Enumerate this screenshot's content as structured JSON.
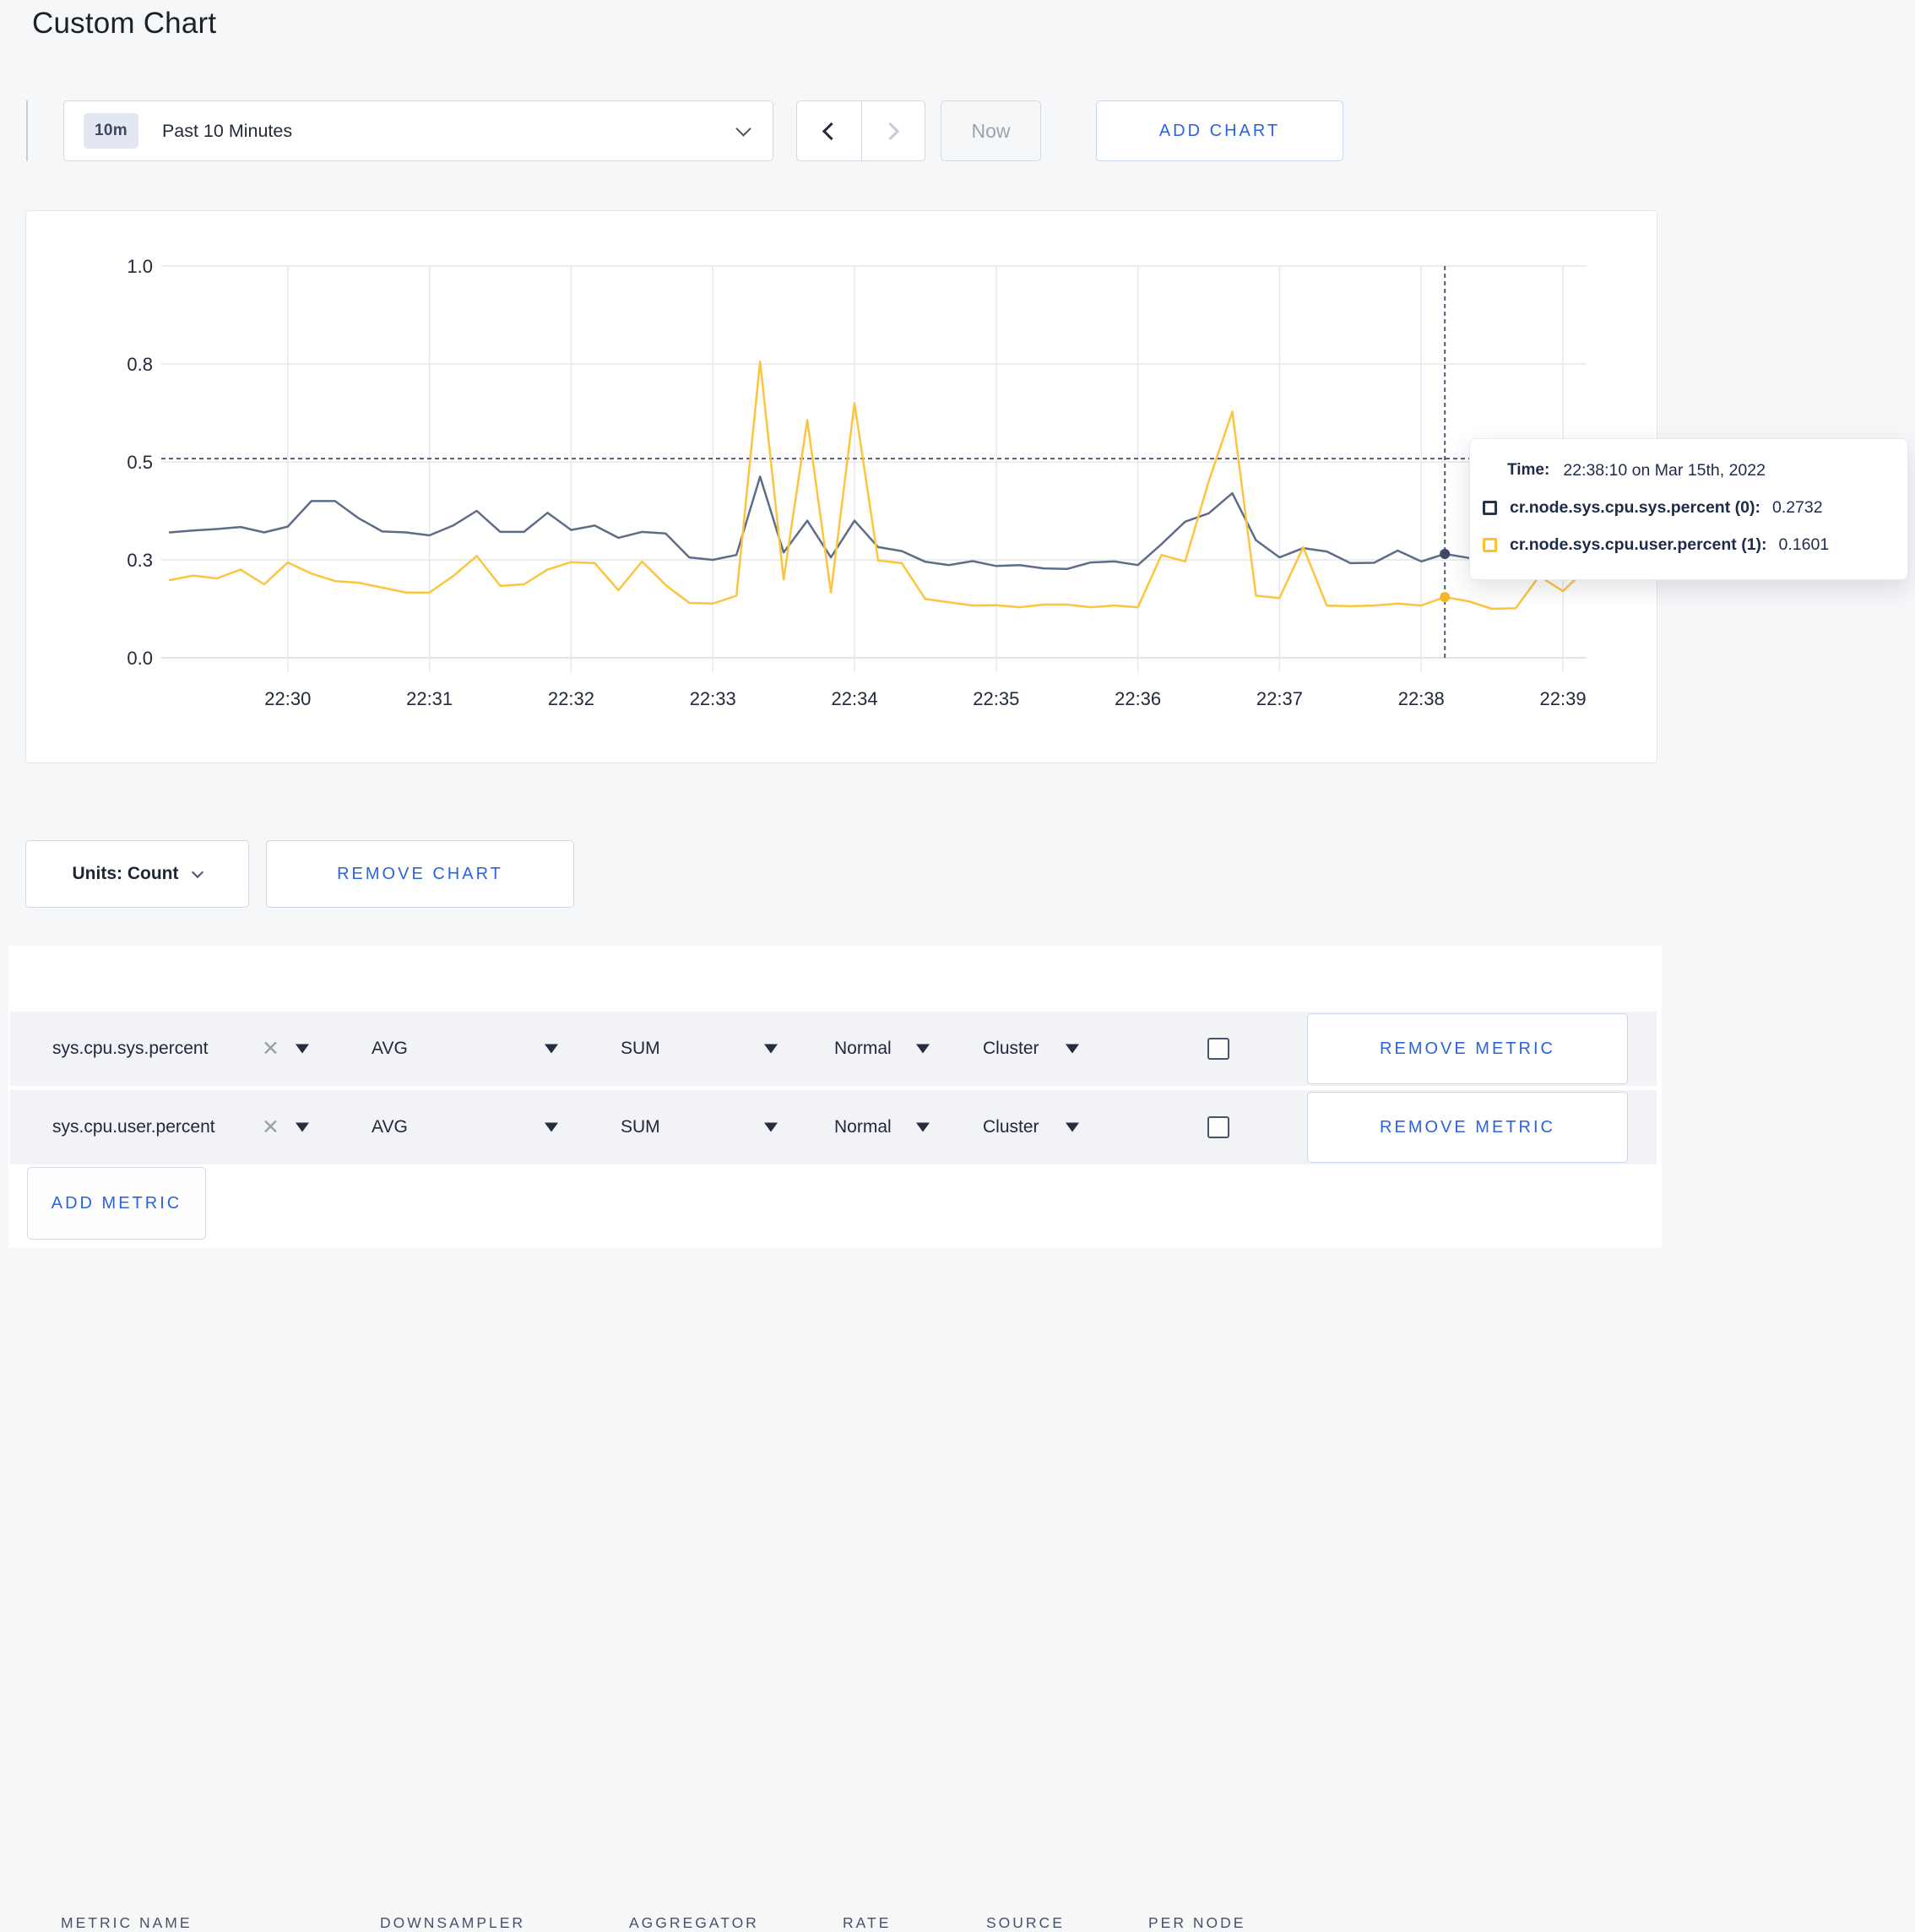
{
  "page": {
    "title": "Custom Chart"
  },
  "toolbar": {
    "time_badge": "10m",
    "time_label": "Past 10 Minutes",
    "time_dropdown_icon": "chevron-down-icon",
    "prev_icon": "chevron-left-icon",
    "next_icon": "chevron-right-icon",
    "now_label": "Now",
    "add_chart_label": "ADD CHART"
  },
  "chart_data": {
    "type": "line",
    "title": "",
    "xlabel": "",
    "ylabel": "",
    "x_tick_labels": [
      "22:30",
      "22:31",
      "22:32",
      "22:33",
      "22:34",
      "22:35",
      "22:36",
      "22:37",
      "22:38",
      "22:39"
    ],
    "y_tick_labels": [
      "0.0",
      "0.3",
      "0.5",
      "0.8",
      "1.0"
    ],
    "y_tick_values": [
      0.0,
      0.3,
      0.5,
      0.8,
      1.0
    ],
    "grid": true,
    "legend_position": "none",
    "start_time": "22:29:10",
    "interval_seconds": 10,
    "series": [
      {
        "name": "cr.node.sys.cpu.sys.percent",
        "color": "#5d6d88",
        "values": [
          0.356,
          0.36,
          0.363,
          0.367,
          0.356,
          0.368,
          0.42,
          0.42,
          0.385,
          0.358,
          0.356,
          0.35,
          0.37,
          0.4,
          0.357,
          0.357,
          0.396,
          0.361,
          0.37,
          0.345,
          0.357,
          0.354,
          0.305,
          0.3,
          0.31,
          0.47,
          0.315,
          0.38,
          0.305,
          0.38,
          0.326,
          0.318,
          0.294,
          0.284,
          0.296,
          0.281,
          0.284,
          0.274,
          0.272,
          0.292,
          0.295,
          0.284,
          0.332,
          0.378,
          0.395,
          0.436,
          0.34,
          0.305,
          0.324,
          0.317,
          0.29,
          0.291,
          0.319,
          0.295,
          0.312,
          0.304,
          0.3,
          0.31,
          0.305,
          0.3,
          0.305
        ]
      },
      {
        "name": "cr.node.sys.cpu.user.percent",
        "color": "#fdc53d",
        "values": [
          0.238,
          0.252,
          0.243,
          0.27,
          0.225,
          0.292,
          0.258,
          0.235,
          0.23,
          0.215,
          0.2,
          0.2,
          0.25,
          0.308,
          0.22,
          0.225,
          0.27,
          0.293,
          0.29,
          0.207,
          0.295,
          0.223,
          0.168,
          0.166,
          0.19,
          0.805,
          0.24,
          0.628,
          0.2,
          0.68,
          0.298,
          0.29,
          0.18,
          0.17,
          0.16,
          0.161,
          0.155,
          0.163,
          0.163,
          0.155,
          0.16,
          0.155,
          0.31,
          0.295,
          0.46,
          0.654,
          0.19,
          0.183,
          0.326,
          0.16,
          0.158,
          0.16,
          0.166,
          0.16,
          0.186,
          0.173,
          0.15,
          0.152,
          0.25,
          0.204,
          0.274
        ]
      }
    ],
    "crosshair": {
      "index": 54,
      "time": "22:38:10",
      "y_value": 0.51
    }
  },
  "tooltip": {
    "time_label": "Time:",
    "time_value": "22:38:10 on Mar 15th, 2022",
    "series": [
      {
        "label": "cr.node.sys.cpu.sys.percent (0):",
        "value": "0.2732",
        "color": "#26334e"
      },
      {
        "label": "cr.node.sys.cpu.user.percent (1):",
        "value": "0.1601",
        "color": "#fdc22e"
      }
    ]
  },
  "chart_controls": {
    "units_label": "Units: Count",
    "units_dropdown_icon": "chevron-down-icon",
    "remove_chart_label": "REMOVE CHART"
  },
  "metrics_table": {
    "headers": [
      "METRIC NAME",
      "DOWNSAMPLER",
      "AGGREGATOR",
      "RATE",
      "SOURCE",
      "PER NODE"
    ],
    "rows": [
      {
        "metric": "sys.cpu.sys.percent",
        "remove_icon": "x-icon",
        "downsampler": "AVG",
        "aggregator": "SUM",
        "rate": "Normal",
        "source": "Cluster",
        "per_node_checked": false,
        "remove_label": "REMOVE METRIC"
      },
      {
        "metric": "sys.cpu.user.percent",
        "remove_icon": "x-icon",
        "downsampler": "AVG",
        "aggregator": "SUM",
        "rate": "Normal",
        "source": "Cluster",
        "per_node_checked": false,
        "remove_label": "REMOVE METRIC"
      }
    ],
    "add_metric_label": "ADD METRIC"
  }
}
